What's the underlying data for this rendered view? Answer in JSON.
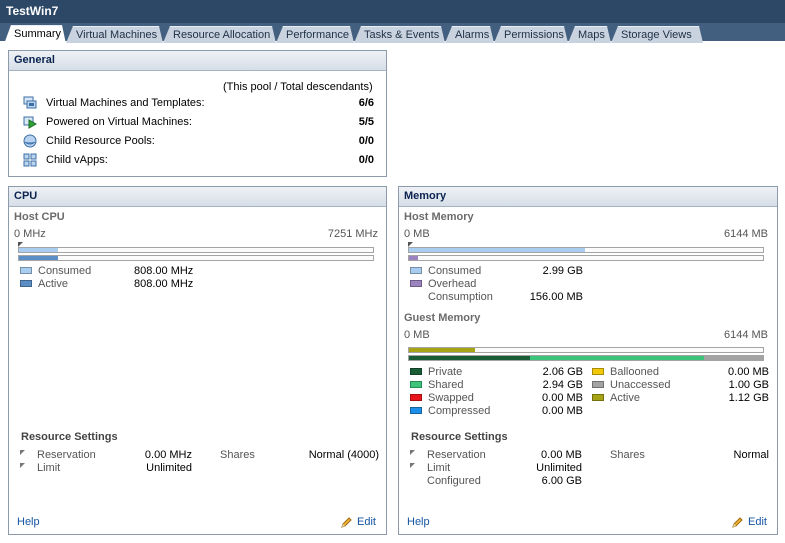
{
  "window": {
    "title": "TestWin7"
  },
  "tabs": [
    "Summary",
    "Virtual Machines",
    "Resource Allocation",
    "Performance",
    "Tasks & Events",
    "Alarms",
    "Permissions",
    "Maps",
    "Storage Views"
  ],
  "active_tab": "Summary",
  "general": {
    "title": "General",
    "note": "(This pool / Total descendants)",
    "rows": [
      {
        "label": "Virtual Machines and Templates:",
        "value": "6/6",
        "icon": "vm-templates-icon"
      },
      {
        "label": "Powered on Virtual Machines:",
        "value": "5/5",
        "icon": "powered-on-vm-icon"
      },
      {
        "label": "Child Resource Pools:",
        "value": "0/0",
        "icon": "resource-pool-icon"
      },
      {
        "label": "Child vApps:",
        "value": "0/0",
        "icon": "vapp-icon"
      }
    ]
  },
  "cpu": {
    "title": "CPU",
    "host_title": "Host CPU",
    "min_label": "0 MHz",
    "max_label": "7251 MHz",
    "consumed_fraction": 0.111,
    "active_fraction": 0.111,
    "legend": [
      {
        "label": "Consumed",
        "value": "808.00 MHz",
        "color": "#a9cdf0"
      },
      {
        "label": "Active",
        "value": "808.00 MHz",
        "color": "#5b8ec4"
      }
    ],
    "resource_settings": {
      "title": "Resource Settings",
      "reservation_label": "Reservation",
      "reservation_value": "0.00 MHz",
      "limit_label": "Limit",
      "limit_value": "Unlimited",
      "shares_label": "Shares",
      "shares_value": "Normal (4000)"
    },
    "help": "Help",
    "edit": "Edit"
  },
  "memory": {
    "title": "Memory",
    "host_title": "Host Memory",
    "host_min": "0 MB",
    "host_max": "6144 MB",
    "host_consumed_fraction": 0.498,
    "host_overhead_fraction": 0.025,
    "host_legend": [
      {
        "label": "Consumed",
        "value": "2.99 GB",
        "color": "#a9cdf0"
      },
      {
        "label": "Overhead",
        "value": "",
        "color": "#9b83c0"
      },
      {
        "label": "Consumption",
        "value": "156.00 MB",
        "color": ""
      }
    ],
    "guest_title": "Guest Memory",
    "guest_min": "0 MB",
    "guest_max": "6144 MB",
    "guest_active_fraction": 0.187,
    "guest_private_fraction": 0.343,
    "guest_shared_fraction": 0.49,
    "guest_unaccessed_fraction": 0.167,
    "guest_legend_left": [
      {
        "label": "Private",
        "value": "2.06 GB",
        "color": "#1a5c36"
      },
      {
        "label": "Shared",
        "value": "2.94 GB",
        "color": "#3cc47a"
      },
      {
        "label": "Swapped",
        "value": "0.00 MB",
        "color": "#e8151b"
      },
      {
        "label": "Compressed",
        "value": "0.00 MB",
        "color": "#1e8fe6"
      }
    ],
    "guest_legend_right": [
      {
        "label": "Ballooned",
        "value": "0.00 MB",
        "color": "#f2c90a"
      },
      {
        "label": "Unaccessed",
        "value": "1.00 GB",
        "color": "#a3a3a3"
      },
      {
        "label": "Active",
        "value": "1.12 GB",
        "color": "#a6a414"
      }
    ],
    "resource_settings": {
      "title": "Resource Settings",
      "reservation_label": "Reservation",
      "reservation_value": "0.00 MB",
      "limit_label": "Limit",
      "limit_value": "Unlimited",
      "configured_label": "Configured",
      "configured_value": "6.00 GB",
      "shares_label": "Shares",
      "shares_value": "Normal"
    },
    "help": "Help",
    "edit": "Edit"
  }
}
